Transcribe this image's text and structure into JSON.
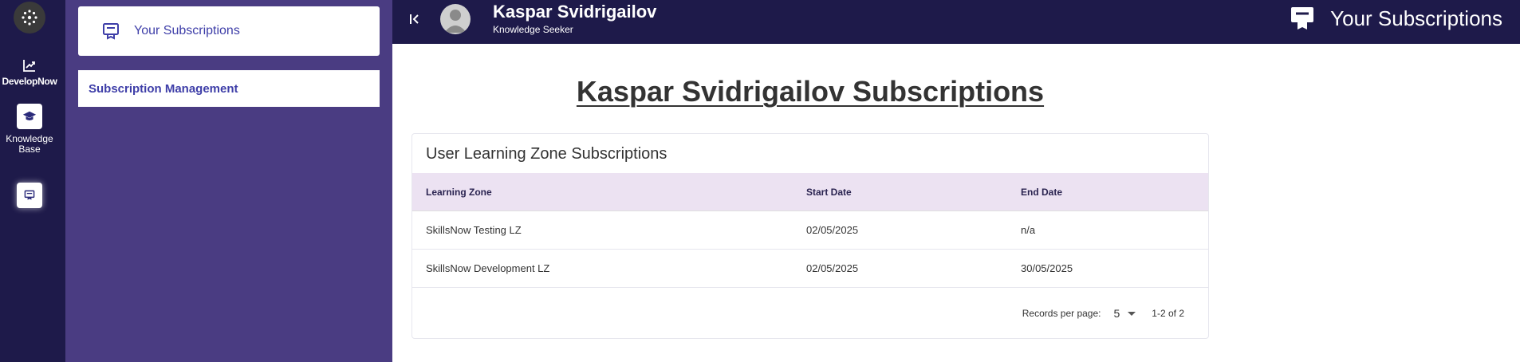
{
  "rail": {
    "items": [
      {
        "label": "DevelopNow",
        "icon": "chart-line-icon"
      },
      {
        "label_line1": "Knowledge",
        "label_line2": "Base",
        "icon": "graduation-cap-icon"
      },
      {
        "icon": "subscriptions-icon"
      }
    ]
  },
  "sidebar": {
    "card_label": "Your Subscriptions",
    "menu_label": "Subscription Management"
  },
  "header": {
    "user_name": "Kaspar Svidrigailov",
    "user_role": "Knowledge Seeker",
    "page_label": "Your Subscriptions"
  },
  "main": {
    "title": "Kaspar Svidrigailov Subscriptions",
    "card_title": "User Learning Zone Subscriptions",
    "columns": [
      "Learning Zone",
      "Start Date",
      "End Date"
    ],
    "rows": [
      [
        "SkillsNow Testing LZ",
        "02/05/2025",
        "n/a"
      ],
      [
        "SkillsNow Development LZ",
        "02/05/2025",
        "30/05/2025"
      ]
    ],
    "pager": {
      "label": "Records per page:",
      "per_page": "5",
      "range": "1-2 of 2"
    }
  },
  "colors": {
    "rail_bg": "#1e1a4a",
    "sidebar_bg": "#4a3c82",
    "accent": "#3e3ea8",
    "table_header_bg": "#ece2f2"
  }
}
